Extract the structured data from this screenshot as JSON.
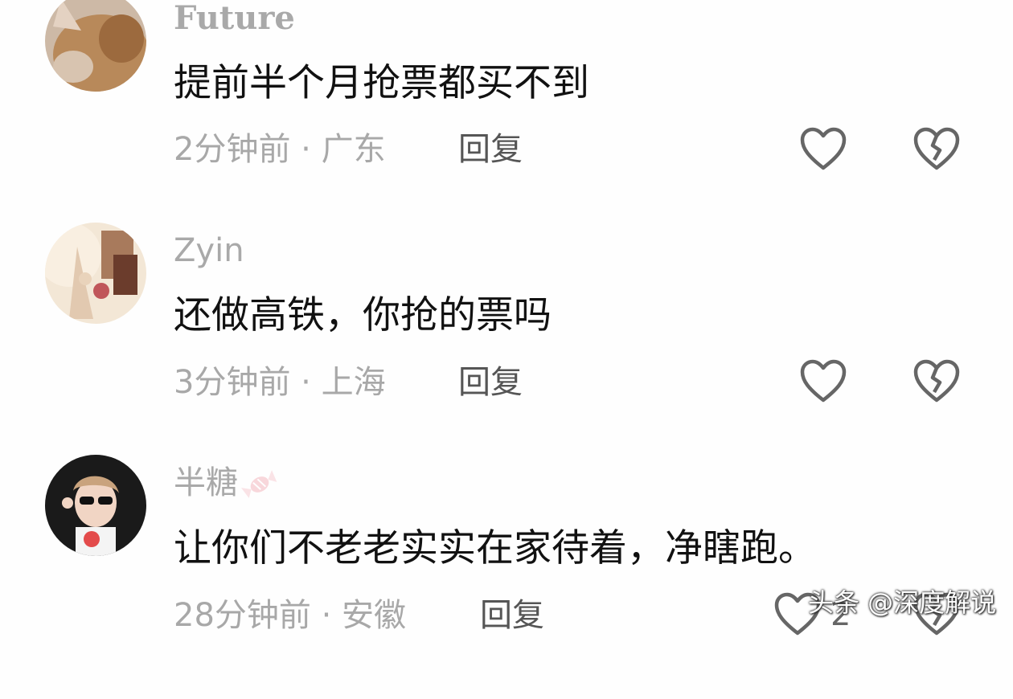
{
  "comments": [
    {
      "username": "Future",
      "text": "提前半个月抢票都买不到",
      "meta": "2分钟前 · 广东",
      "reply": "回复"
    },
    {
      "username": "Zyin",
      "text": "还做高铁，你抢的票吗",
      "meta": "3分钟前 · 上海",
      "reply": "回复"
    },
    {
      "username": "半糖",
      "text": "让你们不老老实实在家待着，净瞎跑。",
      "meta": "28分钟前 · 安徽",
      "reply": "回复",
      "like_count": "2"
    }
  ],
  "watermark": "头条 @深度解说",
  "icons": {
    "like": "heart-outline-icon",
    "dislike": "broken-heart-icon"
  }
}
